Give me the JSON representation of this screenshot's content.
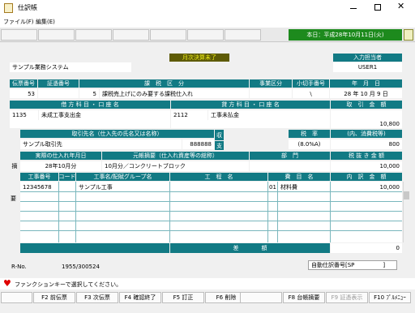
{
  "window": {
    "title": "仕訳帳",
    "minimize_icon": "minimize-icon",
    "maximize_icon": "maximize-icon",
    "close_icon": "close-icon",
    "app_icon": "ledger-app-icon"
  },
  "menu": {
    "file": "ファイル(F)",
    "edit": "編集(E)"
  },
  "toolbar": {
    "date_label": "本日：平成28年10月11日(火)",
    "icon": "tree-icon"
  },
  "header": {
    "status": "月次決算未了",
    "company": "サンプル業務システム",
    "inputter_label": "入力担当者",
    "inputter": "USER1"
  },
  "row1": {
    "headers": {
      "denpyo": "伝票番号",
      "shoko": "証憑番号",
      "kazei": "課　税　区　分",
      "jigyo": "事業区分",
      "kogitte": "小切手番号",
      "date": "年　月　日"
    },
    "values": {
      "denpyo": "53",
      "kazei_code": "5",
      "kazei": "課税売上げにのみ要する課税仕入れ",
      "kogitte": "\\",
      "date": "28 年 10 月  9 日"
    }
  },
  "row2": {
    "headers": {
      "debit": "借 方 科 目 ・ 口 座 名",
      "credit": "貸 方 科 目 ・ 口 座 名",
      "amount": "取　引　金　額"
    },
    "values": {
      "debit_code": "1135",
      "debit_name": "未成工事支出金",
      "credit_code": "2112",
      "credit_name": "工事未払金",
      "amount": "10,800"
    }
  },
  "row3": {
    "headers": {
      "torihiki": "取引先名（仕入先の氏名又は名称）",
      "rate": "税　率",
      "tax": "(内、消費税等)"
    },
    "side": {
      "top": "収",
      "bottom": "支"
    },
    "values": {
      "torihiki": "サンプル取引先",
      "torihiki_code": "888888",
      "rate": "(8.0%A)",
      "tax": "800"
    }
  },
  "row4": {
    "headers": {
      "month": "実際の仕入れ年月日",
      "moto": "元帳摘要（仕入れ資産等の総称）",
      "bumon": "部　門",
      "zeinuki": "税 抜 き 金 額"
    },
    "values": {
      "month": "28年10月分",
      "moto": "10月分／コンクリートブロック",
      "zeinuki": "10,000"
    }
  },
  "side_label": {
    "teki": "摘",
    "yo": "要"
  },
  "detail": {
    "headers": {
      "koji": "工事番号",
      "code": "コード",
      "name": "工事名/配賦グループ名",
      "kotei": "工　程　名",
      "himoku": "費　目　名",
      "uchiwake": "内　訳　金　額"
    },
    "rows": [
      {
        "koji": "12345678",
        "name": "サンプル工事",
        "himoku_code": "01",
        "himoku": "材料費",
        "amount": "10,000"
      }
    ],
    "sagaku_label": "差　　　　額",
    "sagaku": "0"
  },
  "footer": {
    "rno_label": "R-No.",
    "rno": "1955/300524",
    "auto": "自動仕訳番号[SP　　　　　]"
  },
  "status": {
    "icon": "heart-icon",
    "text": "ファンクションキーで選択してください。"
  },
  "fkeys": [
    {
      "label": "F2 前伝票",
      "enabled": true
    },
    {
      "label": "F3 次伝票",
      "enabled": true
    },
    {
      "label": "F4 確認終了",
      "enabled": true
    },
    {
      "label": "F5 訂正",
      "enabled": true
    },
    {
      "label": "F6 削除",
      "enabled": true
    },
    {
      "label": "F8 台帳摘要",
      "enabled": true
    },
    {
      "label": "F9 証憑表示",
      "enabled": false
    },
    {
      "label": "F10 ﾌﾟﾙﾒﾆｭｰ",
      "enabled": true
    }
  ],
  "colors": {
    "teal": "#127a84",
    "status_yellow": "#f0f018",
    "status_olive": "#5e5b05",
    "toolbar_green": "#1d8a1d"
  }
}
